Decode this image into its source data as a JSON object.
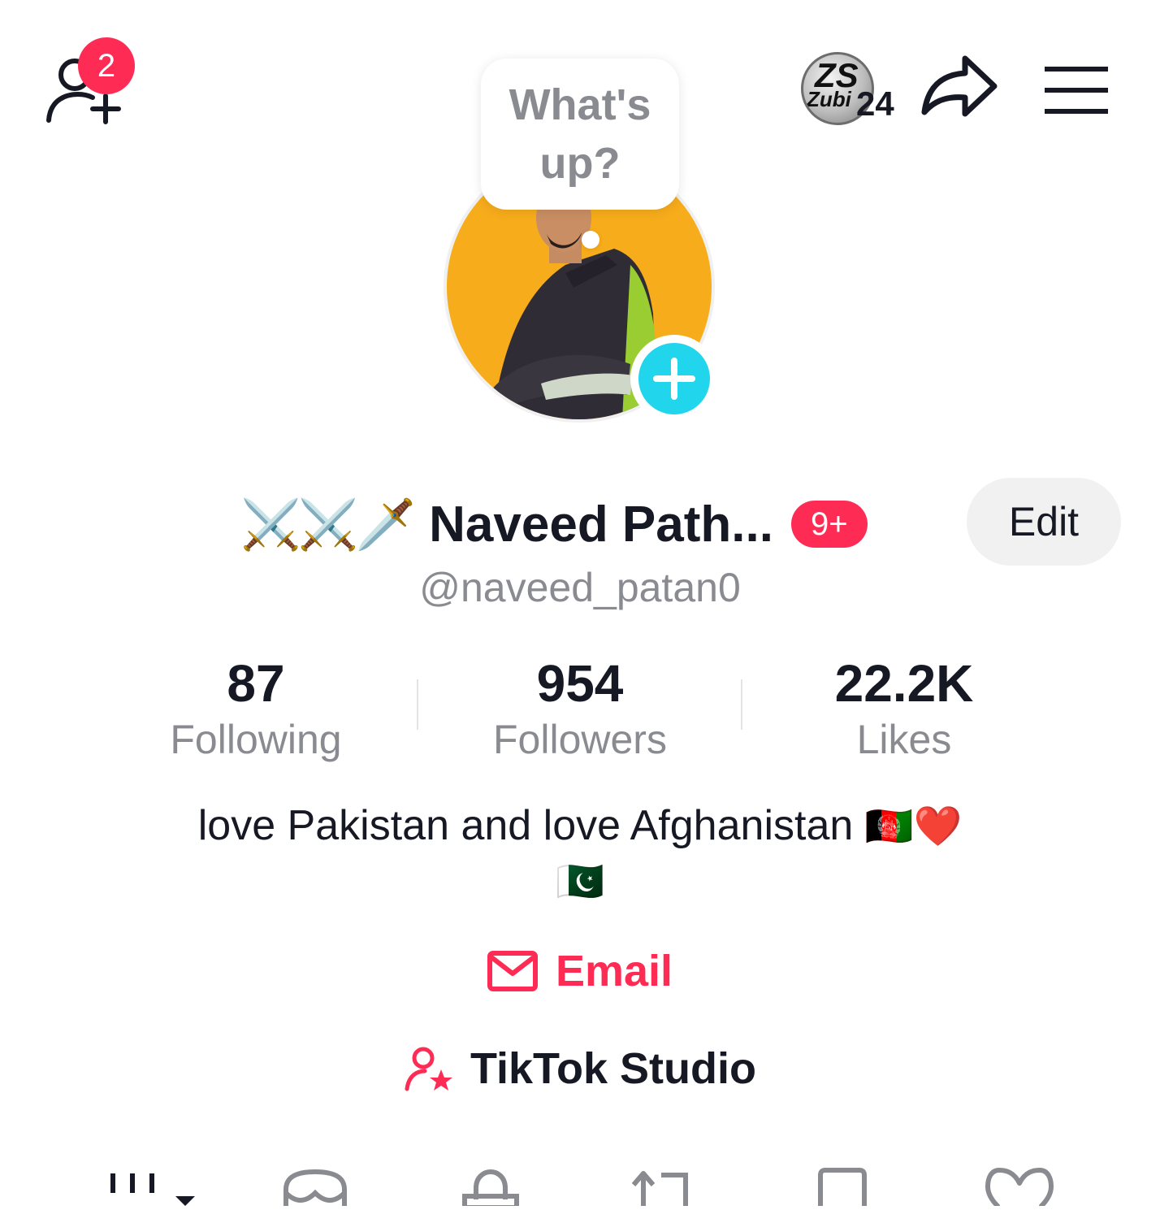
{
  "header": {
    "friend_requests_count": "2",
    "coin_badge": {
      "line1": "ZS",
      "line2": "Zubi",
      "count": "24"
    }
  },
  "avatar": {
    "bubble_text": "What's up?"
  },
  "profile": {
    "emoji_prefix": "⚔️⚔️🗡️",
    "display_name": "Naveed Path...",
    "name_badge": "9+",
    "edit_label": "Edit",
    "username": "@naveed_patan0"
  },
  "stats": {
    "following": {
      "value": "87",
      "label": "Following"
    },
    "followers": {
      "value": "954",
      "label": "Followers"
    },
    "likes": {
      "value": "22.2K",
      "label": "Likes"
    }
  },
  "bio": {
    "line1": "love Pakistan and love Afghanistan",
    "line1_emoji": "🇦🇫❤️",
    "line2": "🇵🇰"
  },
  "links": {
    "email_label": "Email",
    "studio_label": "TikTok Studio"
  },
  "colors": {
    "accent": "#fe2c55",
    "plus": "#20d5ec",
    "avatar_bg": "#f7ac1b",
    "text_primary": "#161823",
    "text_secondary": "#8a8b91"
  },
  "tabs": [
    "videos-grid-icon",
    "shop-icon",
    "lock-icon",
    "repost-icon",
    "bookmark-icon",
    "liked-heart-icon"
  ]
}
